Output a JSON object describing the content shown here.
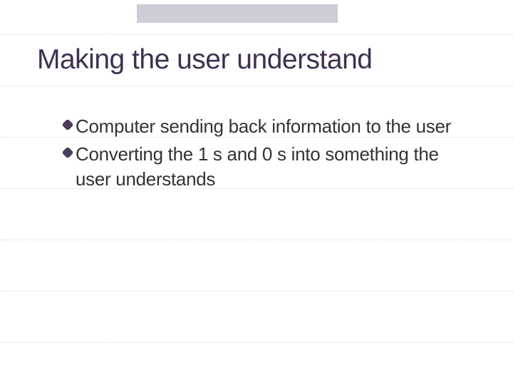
{
  "slide": {
    "title": "Making the user understand",
    "bullets": [
      {
        "text": "Computer sending back information to the user"
      },
      {
        "text": "Converting the 1 s and 0 s into something the user understands"
      }
    ]
  }
}
